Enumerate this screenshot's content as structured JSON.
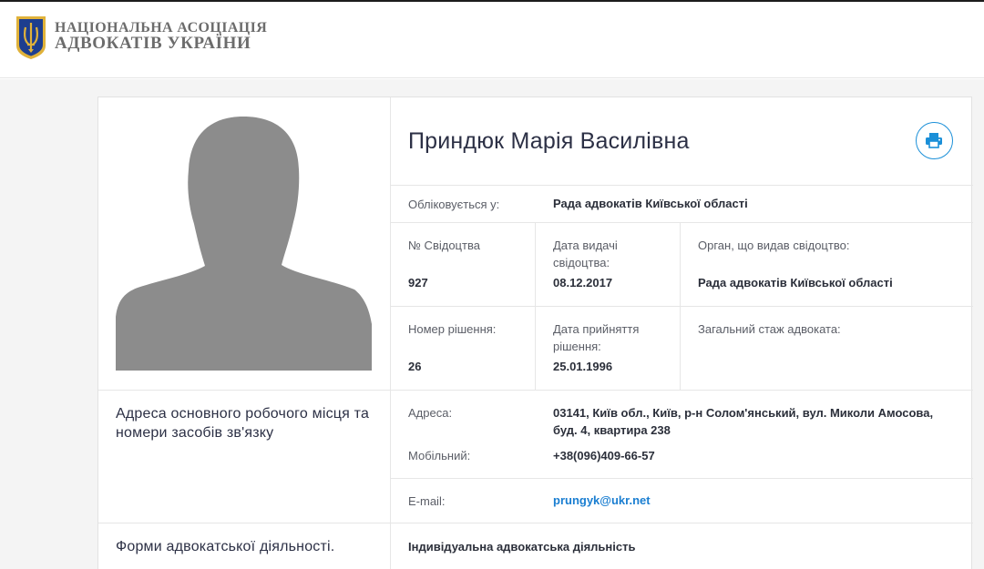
{
  "header": {
    "org_line1": "НАЦІОНАЛЬНА АСОЦІАЦІЯ",
    "org_line2": "АДВОКАТІВ УКРАЇНИ"
  },
  "profile": {
    "name": "Приндюк Марія Василівна",
    "registered_label": "Обліковується у:",
    "registered_value": "Рада адвокатів Київської області",
    "cert_number_label": "№ Свідоцтва",
    "cert_number_value": "927",
    "issue_date_label": "Дата видачі свідоцтва:",
    "issue_date_value": "08.12.2017",
    "issuer_label": "Орган, що видав свідоцтво:",
    "issuer_value": "Рада адвокатів Київської області",
    "decision_number_label": "Номер рішення:",
    "decision_number_value": "26",
    "decision_date_label": "Дата прийняття рішення:",
    "decision_date_value": "25.01.1996",
    "experience_label": "Загальний стаж адвоката:",
    "experience_value": ""
  },
  "contacts": {
    "section_title": "Адреса основного робочого місця та номери засобів зв'язку",
    "address_label": "Адреса:",
    "address_value": "03141, Київ обл., Київ, р-н Солом'янський, вул. Миколи Амосова, буд. 4, квартира 238",
    "mobile_label": "Мобільний:",
    "mobile_value": "+38(096)409-66-57",
    "email_label": "E-mail:",
    "email_value": "prungyk@ukr.net"
  },
  "activity": {
    "section_title": "Форми адвокатської діяльності.",
    "value": "Індивідуальна адвокатська діяльність"
  },
  "icons": {
    "logo": "trident-shield-icon",
    "print": "printer-icon",
    "avatar": "person-silhouette"
  },
  "colors": {
    "accent": "#1a8fd8",
    "logo_blue": "#1d3e8f",
    "logo_gold": "#e0b23a"
  }
}
